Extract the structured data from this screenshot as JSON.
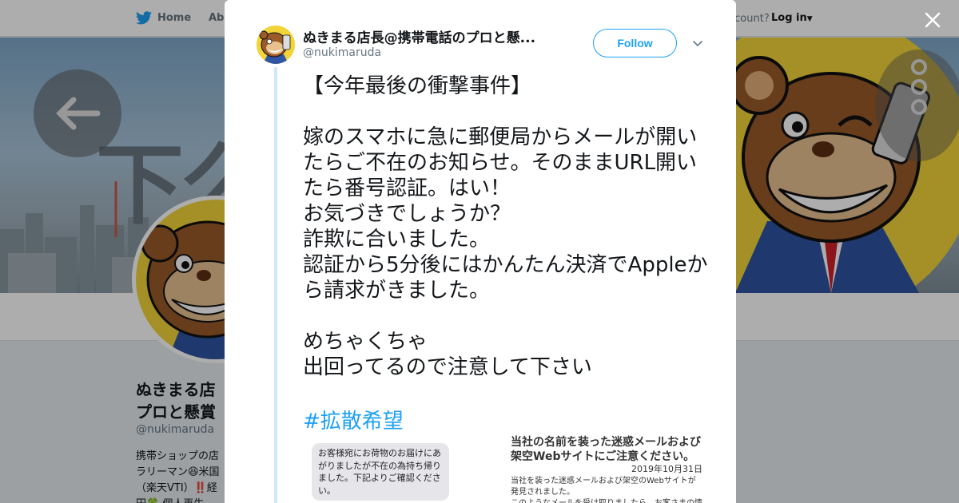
{
  "nav": {
    "home": "Home",
    "about": "Abo",
    "account": "ccount?",
    "login": "Log in"
  },
  "banner": {
    "text": "下么"
  },
  "profile": {
    "name_line1": "ぬきまる店",
    "name_line2": "プロと懸賞",
    "handle": "@nukimaruda",
    "bio_line1": "携帯ショップの店",
    "bio_line2": "ラリーマン😆米国",
    "bio_line3": "（楽天VTI）‼️経",
    "bio_line4": "円🍀 個人再生"
  },
  "tweet": {
    "display_name": "ぬきまる店長@携帯電話のプロと懸...",
    "handle": "@nukimaruda",
    "follow_label": "Follow",
    "text": "【今年最後の衝撃事件】\n\n嫁のスマホに急に郵便局からメールが開いたらご不在のお知らせ。そのままURL開いたら番号認証。はい！\nお気づきでしょうか？\n詐欺に合いました。\n認証から5分後にはかんたん決済でAppleから請求がきました。\n\nめちゃくちゃ\n出回ってるので注意して下さい",
    "hashtag": "#拡散希望"
  },
  "media": {
    "sms_text": "お客様宛にお荷物のお届けにあがりましたが不在の為持ち帰りました。下記よりご確認ください。",
    "notice_title": "当社の名前を装った迷惑メールおよび\n架空Webサイトにご注意ください。",
    "notice_date": "2019年10月31日",
    "notice_text": "当社を装った迷惑メールおよび架空のWebサイトが\n発見されました。\nこのようなメールを受け取りましたら、お客さまの情"
  },
  "colors": {
    "accent": "#1da1f2",
    "thread": "#cde8f8",
    "overlay": "rgba(0,0,0,0.32)"
  },
  "icons": [
    "twitter-bird-icon",
    "close-icon",
    "chevron-down-icon",
    "back-arrow-icon",
    "more-dots-icon"
  ]
}
